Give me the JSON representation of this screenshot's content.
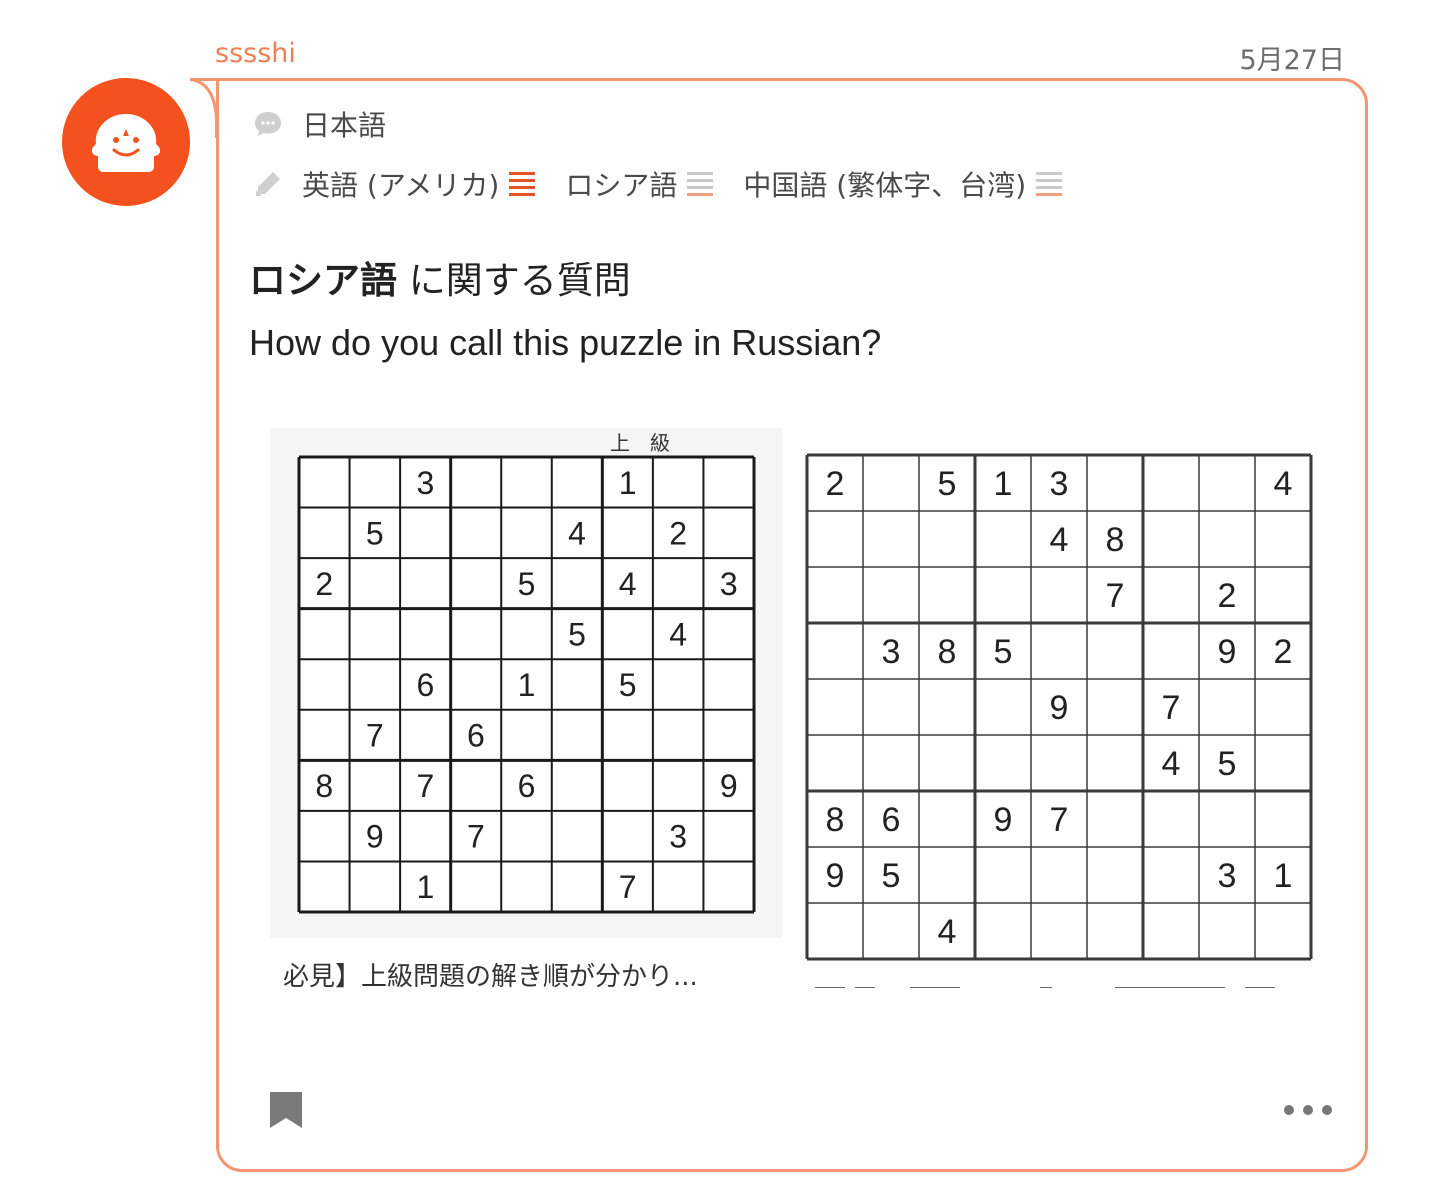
{
  "post": {
    "username": "sssshi",
    "date": "5月27日",
    "native_language": "日本語",
    "learning_languages": [
      {
        "name": "英語 (アメリカ)",
        "level_bars": 4,
        "color": "#e8542a"
      },
      {
        "name": "ロシア語",
        "level_bars": 1,
        "color": "#e8542a"
      },
      {
        "name": "中国語 (繁体字、台湾)",
        "level_bars": 1,
        "color": "#e8542a"
      }
    ],
    "title_language": "ロシア語",
    "title_suffix": " に関する質問",
    "question": "How do you call this puzzle in Russian?"
  },
  "images": [
    {
      "caption": "必見】上級問題の解き順が分かり...",
      "header_text": "上　級",
      "grid": [
        [
          0,
          0,
          3,
          0,
          0,
          0,
          1,
          0,
          0
        ],
        [
          0,
          5,
          0,
          0,
          0,
          4,
          0,
          2,
          0
        ],
        [
          2,
          0,
          0,
          0,
          5,
          0,
          4,
          0,
          3
        ],
        [
          0,
          0,
          0,
          0,
          0,
          5,
          0,
          4,
          0
        ],
        [
          0,
          0,
          6,
          0,
          1,
          0,
          5,
          0,
          0
        ],
        [
          0,
          7,
          0,
          6,
          0,
          0,
          0,
          0,
          0
        ],
        [
          8,
          0,
          7,
          0,
          6,
          0,
          0,
          0,
          9
        ],
        [
          0,
          9,
          0,
          7,
          0,
          0,
          0,
          3,
          0
        ],
        [
          0,
          0,
          1,
          0,
          0,
          0,
          7,
          0,
          0
        ]
      ]
    },
    {
      "grid": [
        [
          2,
          0,
          5,
          1,
          3,
          0,
          0,
          0,
          4
        ],
        [
          0,
          0,
          0,
          0,
          4,
          8,
          0,
          0,
          0
        ],
        [
          0,
          0,
          0,
          0,
          0,
          7,
          0,
          2,
          0
        ],
        [
          0,
          3,
          8,
          5,
          0,
          0,
          0,
          9,
          2
        ],
        [
          0,
          0,
          0,
          0,
          9,
          0,
          7,
          0,
          0
        ],
        [
          0,
          0,
          0,
          0,
          0,
          0,
          4,
          5,
          0
        ],
        [
          8,
          6,
          0,
          9,
          7,
          0,
          0,
          0,
          0
        ],
        [
          9,
          5,
          0,
          0,
          0,
          0,
          0,
          3,
          1
        ],
        [
          0,
          0,
          4,
          0,
          0,
          0,
          0,
          0,
          0
        ]
      ]
    }
  ],
  "colors": {
    "accent": "#f4511e",
    "border": "#f39472",
    "username": "#f07f56"
  },
  "icons": {
    "native": "speech-bubble-icon",
    "learning": "pencil-icon",
    "bookmark": "bookmark-icon",
    "more": "more-dots-icon"
  }
}
